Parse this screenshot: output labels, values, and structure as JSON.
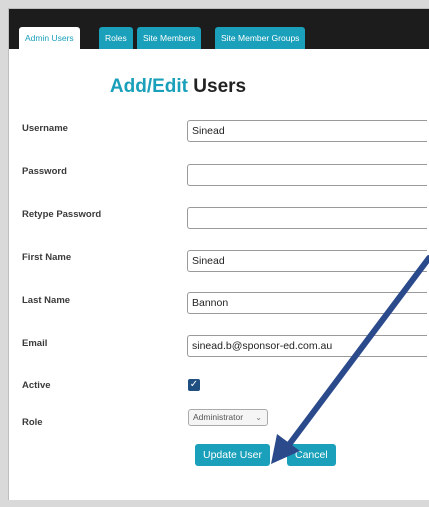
{
  "tabs": [
    {
      "label": "Admin Users",
      "active": true
    },
    {
      "label": "Roles"
    },
    {
      "label": "Site Members"
    },
    {
      "label": "Site Member Groups"
    }
  ],
  "page": {
    "title_accent": "Add/Edit",
    "title_rest": "Users"
  },
  "form": {
    "username": {
      "label": "Username",
      "value": "Sinead"
    },
    "password": {
      "label": "Password",
      "value": ""
    },
    "retype_password": {
      "label": "Retype Password",
      "value": ""
    },
    "first_name": {
      "label": "First Name",
      "value": "Sinead"
    },
    "last_name": {
      "label": "Last Name",
      "value": "Bannon"
    },
    "email": {
      "label": "Email",
      "value": "sinead.b@sponsor-ed.com.au"
    },
    "active": {
      "label": "Active",
      "checked": true
    },
    "role": {
      "label": "Role",
      "selected": "Administrator"
    }
  },
  "buttons": {
    "update": "Update User",
    "cancel": "Cancel"
  },
  "colors": {
    "accent": "#1aa0ba",
    "annotation_arrow": "#2b4a8c"
  }
}
